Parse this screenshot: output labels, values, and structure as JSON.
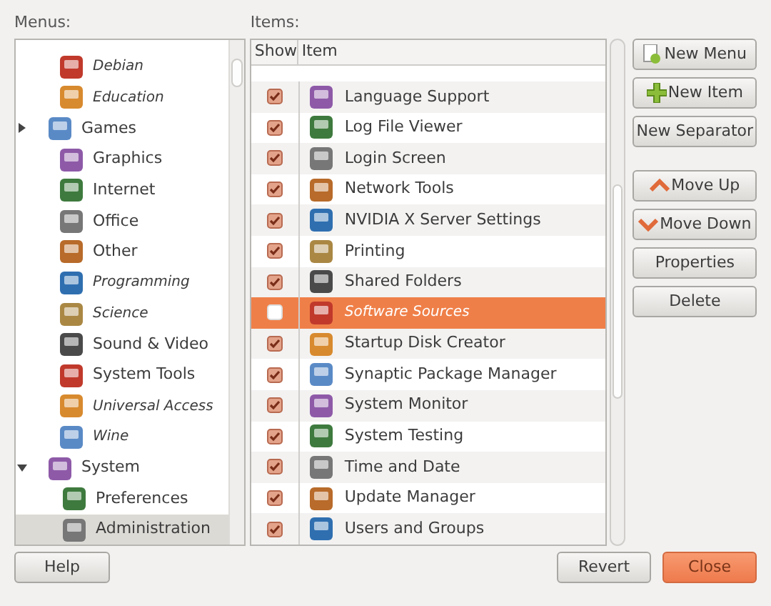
{
  "menus": {
    "label": "Menus:",
    "items": [
      {
        "label": "Debian",
        "hidden": true
      },
      {
        "label": "Education",
        "hidden": true
      },
      {
        "label": "Games",
        "hidden": false,
        "expanded": false
      },
      {
        "label": "Graphics",
        "hidden": false
      },
      {
        "label": "Internet",
        "hidden": false
      },
      {
        "label": "Office",
        "hidden": false
      },
      {
        "label": "Other",
        "hidden": false
      },
      {
        "label": "Programming",
        "hidden": true
      },
      {
        "label": "Science",
        "hidden": true
      },
      {
        "label": "Sound & Video",
        "hidden": false
      },
      {
        "label": "System Tools",
        "hidden": false
      },
      {
        "label": "Universal Access",
        "hidden": true
      },
      {
        "label": "Wine",
        "hidden": true
      },
      {
        "label": "System",
        "hidden": false,
        "expanded": true,
        "children": [
          {
            "label": "Preferences",
            "hidden": false,
            "selected": false
          },
          {
            "label": "Administration",
            "hidden": false,
            "selected": true
          }
        ]
      }
    ]
  },
  "items": {
    "label": "Items:",
    "columns": [
      "Show",
      "Item"
    ],
    "rows": [
      {
        "label": "Language Support",
        "checked": true,
        "selected": false
      },
      {
        "label": "Log File Viewer",
        "checked": true,
        "selected": false
      },
      {
        "label": "Login Screen",
        "checked": true,
        "selected": false
      },
      {
        "label": "Network Tools",
        "checked": true,
        "selected": false
      },
      {
        "label": "NVIDIA X Server Settings",
        "checked": true,
        "selected": false
      },
      {
        "label": "Printing",
        "checked": true,
        "selected": false
      },
      {
        "label": "Shared Folders",
        "checked": true,
        "selected": false
      },
      {
        "label": "Software Sources",
        "checked": false,
        "selected": true
      },
      {
        "label": "Startup Disk Creator",
        "checked": true,
        "selected": false
      },
      {
        "label": "Synaptic Package Manager",
        "checked": true,
        "selected": false
      },
      {
        "label": "System Monitor",
        "checked": true,
        "selected": false
      },
      {
        "label": "System Testing",
        "checked": true,
        "selected": false
      },
      {
        "label": "Time and Date",
        "checked": true,
        "selected": false
      },
      {
        "label": "Update Manager",
        "checked": true,
        "selected": false
      },
      {
        "label": "Users and Groups",
        "checked": true,
        "selected": false
      }
    ]
  },
  "side_button_groups": [
    [
      {
        "label": "New Menu",
        "kind": "new-menu"
      },
      {
        "label": "New Item",
        "kind": "new-item"
      },
      {
        "label": "New Separator",
        "kind": "plain"
      }
    ],
    [
      {
        "label": "Move Up",
        "kind": "move-up"
      },
      {
        "label": "Move Down",
        "kind": "move-down"
      },
      {
        "label": "Properties",
        "kind": "plain"
      },
      {
        "label": "Delete",
        "kind": "plain"
      }
    ]
  ],
  "bottom_buttons": [
    {
      "label": "Help",
      "kind": "normal"
    },
    {
      "label": "Revert",
      "kind": "normal"
    },
    {
      "label": "Close",
      "kind": "primary"
    }
  ]
}
